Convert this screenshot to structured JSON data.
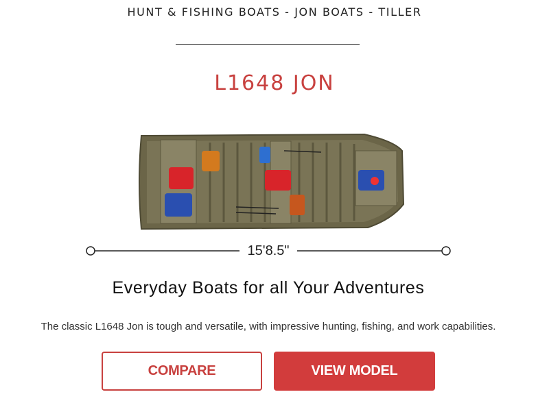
{
  "breadcrumb": "HUNT & FISHING BOATS - JON BOATS - TILLER",
  "model": {
    "title": "L1648 JON"
  },
  "length": {
    "label": "15'8.5\""
  },
  "tagline": "Everyday Boats for all Your Adventures",
  "description": "The classic L1648 Jon is tough and versatile, with impressive hunting, fishing, and work capabilities.",
  "buttons": {
    "compare": "COMPARE",
    "view_model": "VIEW MODEL"
  },
  "colors": {
    "accent": "#c8413f",
    "button_fill": "#d23c3c",
    "hull": "#6b6548"
  }
}
